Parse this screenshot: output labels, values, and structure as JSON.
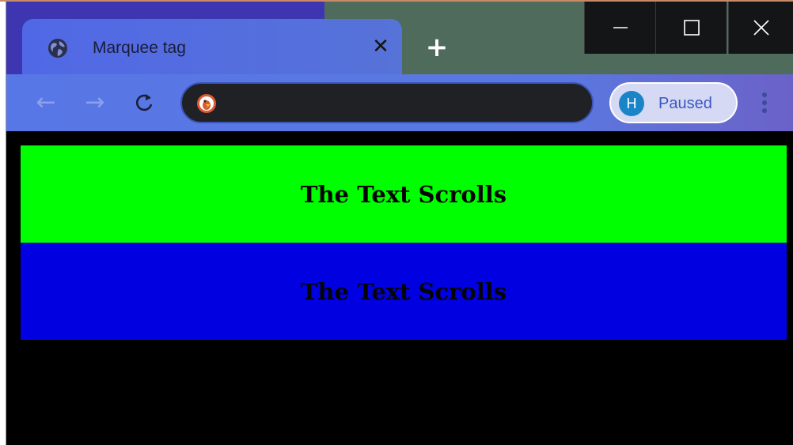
{
  "browser": {
    "tab": {
      "title": "Marquee tag",
      "icon": "globe-icon",
      "close_glyph": "✕"
    },
    "new_tab_glyph": "+",
    "window_controls": {
      "minimize": "—",
      "maximize": "☐",
      "close": "✕"
    },
    "nav": {
      "back_glyph": "←",
      "forward_glyph": "→",
      "reload_glyph": "↻"
    },
    "address_bar": {
      "value": "",
      "icon": "duckduckgo-icon"
    },
    "profile": {
      "initial": "H",
      "status": "Paused"
    },
    "menu_icon": "kebab-menu-icon"
  },
  "page": {
    "marquees": [
      {
        "text": "The Text Scrolls",
        "background": "#00ff00"
      },
      {
        "text": "The Text Scrolls",
        "background": "#0000e0"
      }
    ],
    "background": "#000000"
  },
  "colors": {
    "titlebar_left": "#3e36b0",
    "titlebar_right": "#4e6b5b",
    "tab": "#5168e6",
    "toolbar": "#5877e6",
    "omnibox": "#202124"
  }
}
